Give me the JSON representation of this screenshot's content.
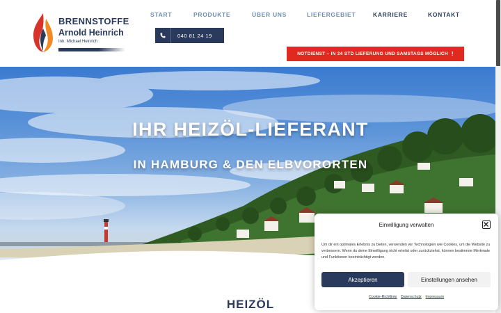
{
  "logo": {
    "name_line1": "BRENNSTOFFE",
    "name_line2": "Arnold Heinrich",
    "owner": "Inh. Michael Heinrich",
    "icon": "flame-icon"
  },
  "nav": {
    "items": [
      {
        "label": "START"
      },
      {
        "label": "PRODUKTE"
      },
      {
        "label": "ÜBER UNS"
      },
      {
        "label": "LIEFERGEBIET"
      },
      {
        "label": "KARRIERE"
      },
      {
        "label": "KONTAKT"
      }
    ]
  },
  "phone": {
    "number": "040 81 24 19",
    "icon": "phone-icon"
  },
  "notdienst": {
    "label": "NOTDIENST – IN 24 STD LIEFERUNG UND SAMSTAGS MÖGLICH",
    "icon": "exclamation-icon"
  },
  "hero": {
    "title": "IHR HEIZÖL-LIEFERANT",
    "subtitle": "IN HAMBURG & DEN ELBVORORTEN"
  },
  "section": {
    "title": "HEIZÖL"
  },
  "cookie": {
    "title": "Einwilligung verwalten",
    "text": "Um dir ein optimales Erlebnis zu bieten, verwenden wir Technologien wie Cookies, um die Website zu verbessern. Wenn du deine Einwilligung nicht erteilst oder zurückziehst, können bestimmte Merkmale und Funktionen beeinträchtigt werden.",
    "accept_label": "Akzeptieren",
    "settings_label": "Einstellungen ansehen",
    "links": [
      "Cookie-Richtlinie",
      "Datenschutz",
      "Impressum"
    ],
    "close_icon": "close-icon"
  },
  "colors": {
    "navy": "#2a3a5c",
    "nav_light": "#6b8cb4",
    "alert_red": "#e02a1f",
    "flame_red": "#d6332a",
    "flame_orange": "#f08a24"
  }
}
